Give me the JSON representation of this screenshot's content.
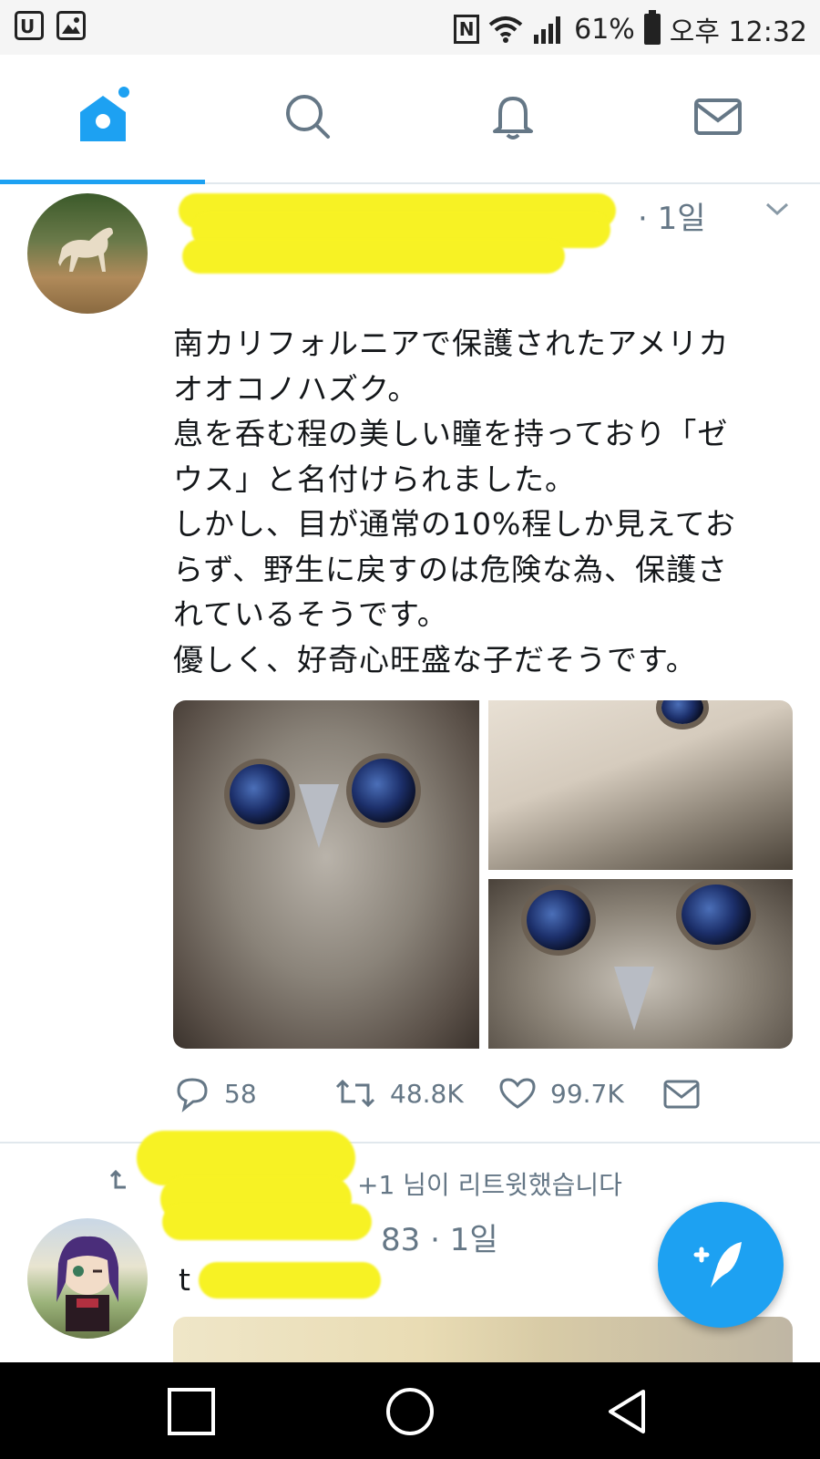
{
  "status_bar": {
    "battery": "61%",
    "time": "오후 12:32",
    "nfc_letter": "N"
  },
  "tabs": [
    {
      "name": "home",
      "icon": "home-icon",
      "active": true
    },
    {
      "name": "search",
      "icon": "search-icon",
      "active": false
    },
    {
      "name": "notifications",
      "icon": "bell-icon",
      "active": false
    },
    {
      "name": "messages",
      "icon": "mail-icon",
      "active": false
    }
  ],
  "tweet1": {
    "time": "· 1일",
    "text_lines": [
      "南カリフォルニアで保護されたアメリカ",
      "オオコノハズク。",
      "息を呑む程の美しい瞳を持っており「ゼ",
      "ウス」と名付けられました。",
      "しかし、目が通常の10%程しか見えてお",
      "らず、野生に戻すのは危険な為、保護さ",
      "れているそうです。",
      "優しく、好奇心旺盛な子だそうです。"
    ],
    "replies": "58",
    "retweets": "48.8K",
    "likes": "99.7K"
  },
  "tweet2": {
    "retweet_context": "+1 님이 리트윗했습니다",
    "handle_time": "83 · 1일",
    "text_start": "t"
  },
  "colors": {
    "accent": "#1da1f2",
    "muted": "#657786",
    "redaction": "#f7f224"
  }
}
